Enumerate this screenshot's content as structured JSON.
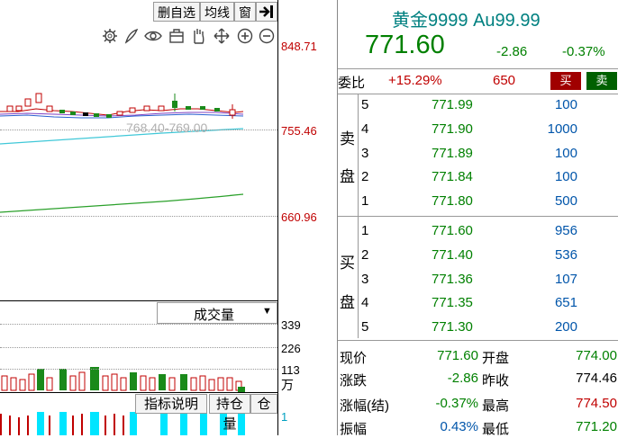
{
  "toolbar": {
    "delete_watchlist": "删自选",
    "ma_line": "均线",
    "window": "窗",
    "collapse_icon": "collapse-right-arrow"
  },
  "tools": [
    "gear-icon",
    "pen-icon",
    "eye-icon",
    "briefcase-icon",
    "hand-icon",
    "zoom-in-icon",
    "zoom-out-icon"
  ],
  "chart": {
    "price_labels": [
      "848.71",
      "755.46",
      "660.96"
    ],
    "price_line_label": "768.40-769.00",
    "volume_selector": "成交量",
    "volume_labels": [
      "339",
      "226",
      "113"
    ],
    "volume_unit": "万",
    "indicator_button": "指标说明",
    "position_tabs": [
      "持仓量",
      "仓差"
    ],
    "oi_label": "1"
  },
  "quote": {
    "name": "黄金9999",
    "code": "Au99.99",
    "price": "771.60",
    "change": "-2.86",
    "change_pct": "-0.37%",
    "weibi_label": "委比",
    "weibi_value": "+15.29%",
    "weicha_value": "650",
    "buy_button": "买",
    "sell_button": "卖",
    "sell_side_label": [
      "卖",
      "盘"
    ],
    "buy_side_label": [
      "买",
      "盘"
    ],
    "asks": [
      {
        "level": "5",
        "price": "771.99",
        "volume": "100"
      },
      {
        "level": "4",
        "price": "771.90",
        "volume": "1000"
      },
      {
        "level": "3",
        "price": "771.89",
        "volume": "100"
      },
      {
        "level": "2",
        "price": "771.84",
        "volume": "100"
      },
      {
        "level": "1",
        "price": "771.80",
        "volume": "500"
      }
    ],
    "bids": [
      {
        "level": "1",
        "price": "771.60",
        "volume": "956"
      },
      {
        "level": "2",
        "price": "771.40",
        "volume": "536"
      },
      {
        "level": "3",
        "price": "771.36",
        "volume": "107"
      },
      {
        "level": "4",
        "price": "771.35",
        "volume": "651"
      },
      {
        "level": "5",
        "price": "771.30",
        "volume": "200"
      }
    ],
    "summary": {
      "current_label": "现价",
      "current_value": "771.60",
      "open_label": "开盘",
      "open_value": "774.00",
      "change_label": "涨跌",
      "change_value": "-2.86",
      "prev_close_label": "昨收",
      "prev_close_value": "774.46",
      "change_pct_label": "涨幅(结)",
      "change_pct_value": "-0.37%",
      "high_label": "最高",
      "high_value": "774.50",
      "amplitude_label": "振幅",
      "amplitude_value": "0.43%",
      "low_label": "最低",
      "low_value": "771.20"
    }
  },
  "colors": {
    "up": "#c00000",
    "down": "#008000",
    "volume_bar_down": "#1a8a1a",
    "oi_bar": "#00e5ff",
    "ma_cyan": "#40c8d8",
    "ma_green": "#2aa02a",
    "sell_btn": "#a00000",
    "buy_btn": "#006000"
  }
}
